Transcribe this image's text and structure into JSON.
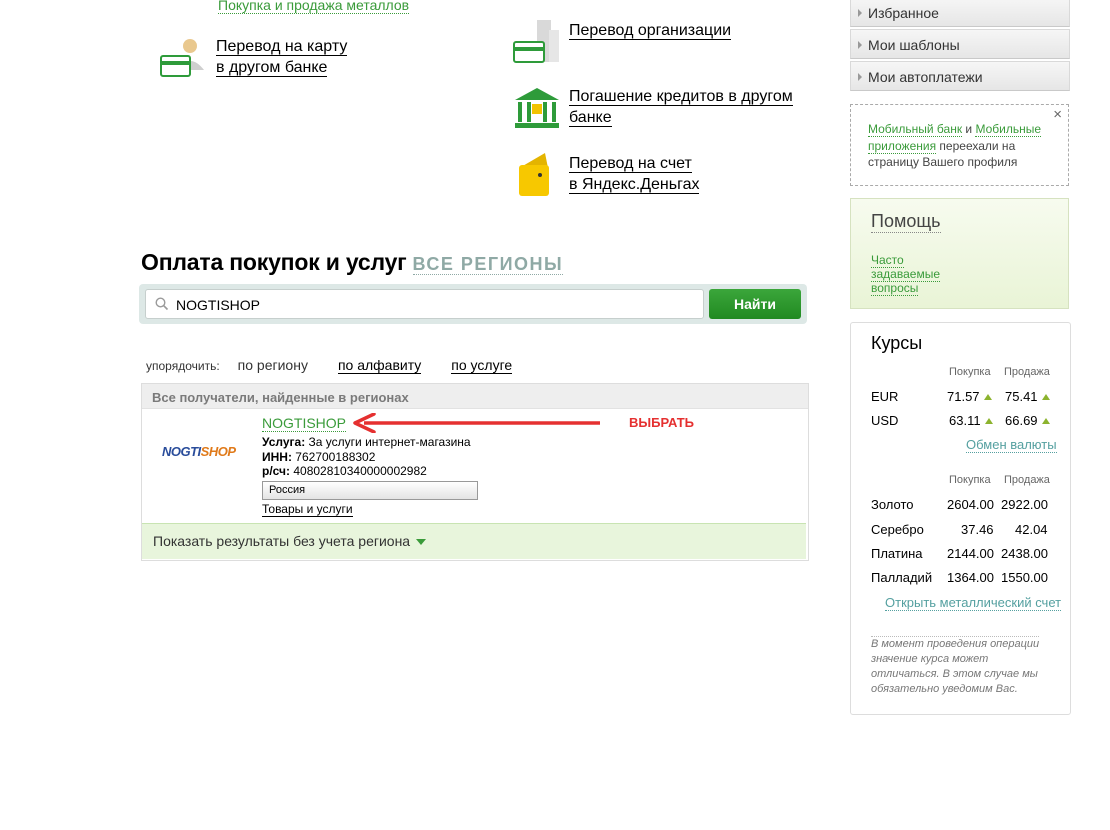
{
  "top": {
    "metals_link": "Покупка и продажа металлов",
    "ops": [
      {
        "line1": "Перевод на карту",
        "line2": "в другом банке"
      },
      {
        "line1": "Перевод организации",
        "line2": ""
      },
      {
        "line1": "Погашение кредитов в другом",
        "line2": "банке"
      },
      {
        "line1": "Перевод на счет",
        "line2": "в Яндекс.Деньгах"
      }
    ]
  },
  "payments": {
    "title": "Оплата покупок и услуг",
    "regions_link": "все регионы",
    "search_value": "NOGTISHOP",
    "search_button": "Найти",
    "sort_label": "упорядочить:",
    "sort_options": [
      "по региону",
      "по алфавиту",
      "по услуге"
    ],
    "results_header": "Все получатели, найденные в регионах",
    "result": {
      "logo_text": "NOGTISHOP",
      "name": "NOGTISHOP",
      "service_label": "Услуга:",
      "service_value": "За услуги интернет-магазина",
      "inn_label": "ИНН:",
      "inn_value": "762700188302",
      "account_label": "р/сч:",
      "account_value": "40802810340000002982",
      "region": "Россия",
      "goods_link": "Товары и услуги"
    },
    "footer_link": "Показать результаты без учета региона",
    "annotation": "ВЫБРАТЬ"
  },
  "sidebar": {
    "menu": [
      "Избранное",
      "Мои шаблоны",
      "Мои автоплатежи"
    ],
    "notice": {
      "link1": "Мобильный банк",
      "and": " и ",
      "link2": "Мобильные приложения",
      "rest": " переехали на страницу Вашего профиля",
      "close": "×"
    },
    "help": {
      "title": "Помощь",
      "faq": "Часто задаваемые вопросы"
    },
    "rates": {
      "title": "Курсы",
      "buy": "Покупка",
      "sell": "Продажа",
      "currencies": [
        {
          "code": "EUR",
          "buy": "71.57",
          "sell": "75.41"
        },
        {
          "code": "USD",
          "buy": "63.11",
          "sell": "66.69"
        }
      ],
      "exchange_link": "Обмен валюты",
      "metals": [
        {
          "name": "Золото",
          "buy": "2604.00",
          "sell": "2922.00"
        },
        {
          "name": "Серебро",
          "buy": "37.46",
          "sell": "42.04"
        },
        {
          "name": "Платина",
          "buy": "2144.00",
          "sell": "2438.00"
        },
        {
          "name": "Палладий",
          "buy": "1364.00",
          "sell": "1550.00"
        }
      ],
      "metal_account_link": "Открыть металлический счет",
      "note": "В момент проведения операции значение курса может отличаться. В этом случае мы обязательно уведомим Вас."
    }
  },
  "colors": {
    "brand_green": "#3a9b3a",
    "button_green": "#2a962a",
    "annotation_red": "#e53030"
  }
}
